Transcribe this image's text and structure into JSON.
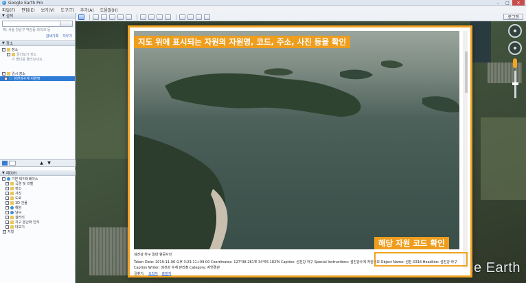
{
  "window": {
    "title": "Google Earth Pro",
    "controls": [
      "–",
      "□",
      "✕"
    ]
  },
  "menu": [
    "파일(F)",
    "편집(E)",
    "보기(V)",
    "도구(T)",
    "추가(A)",
    "도움말(H)"
  ],
  "toolbar": {
    "login_label": "로그인"
  },
  "sidebar": {
    "search": {
      "head": "검색",
      "placeholder": "",
      "hint": "예: 서울 강남구 역삼동 라이크 등",
      "links": [
        "검색기록",
        "지우기"
      ]
    },
    "places": {
      "head": "장소",
      "items": [
        {
          "label": "장소",
          "dim": false,
          "selected": false
        },
        {
          "label": "둘러보기 장소",
          "dim": true,
          "selected": false
        },
        {
          "label": "이 폴더를 둘러보세요.",
          "dim": true,
          "selected": false
        },
        {
          "label": "임시 장소",
          "dim": false,
          "selected": false
        },
        {
          "label": "섬진강수계 자원명",
          "dim": false,
          "selected": true
        }
      ]
    },
    "layers": {
      "head": "레이어",
      "items": [
        "기본 데이터베이스",
        "국경 및 라벨",
        "장소",
        "사진",
        "도로",
        "3D 건물",
        "해양",
        "날씨",
        "갤러리",
        "지구 온난화 인식",
        "더보기",
        "지형"
      ]
    }
  },
  "map": {
    "logo": "Google Earth"
  },
  "popup": {
    "caption_title": "섬진강 하구 일대 항공사진",
    "caption_text": "Taken Date: 2019-11-06 오후 3:23:11+09:00 Coordinates: 127°38.281'E 34°55.182'N Caption: 섬진강 하구 Special Instructions: 섬진강수계 자원정보 Object Name: 섬진-0316 Headline: 섬진강 하구 Caption Writer: 섬진강 수계 관리청 Category: 자연경관",
    "links": [
      "길찾기:",
      "도착지",
      "출발지"
    ]
  },
  "annotations": {
    "top": "지도 위에 표시되는 자원의 자원명, 코드, 주소, 사진 등을 확인",
    "bottom": "해당 자원 코드 확인"
  },
  "colors": {
    "accent": "#ee9d1d",
    "selection": "#2e7bd6"
  }
}
